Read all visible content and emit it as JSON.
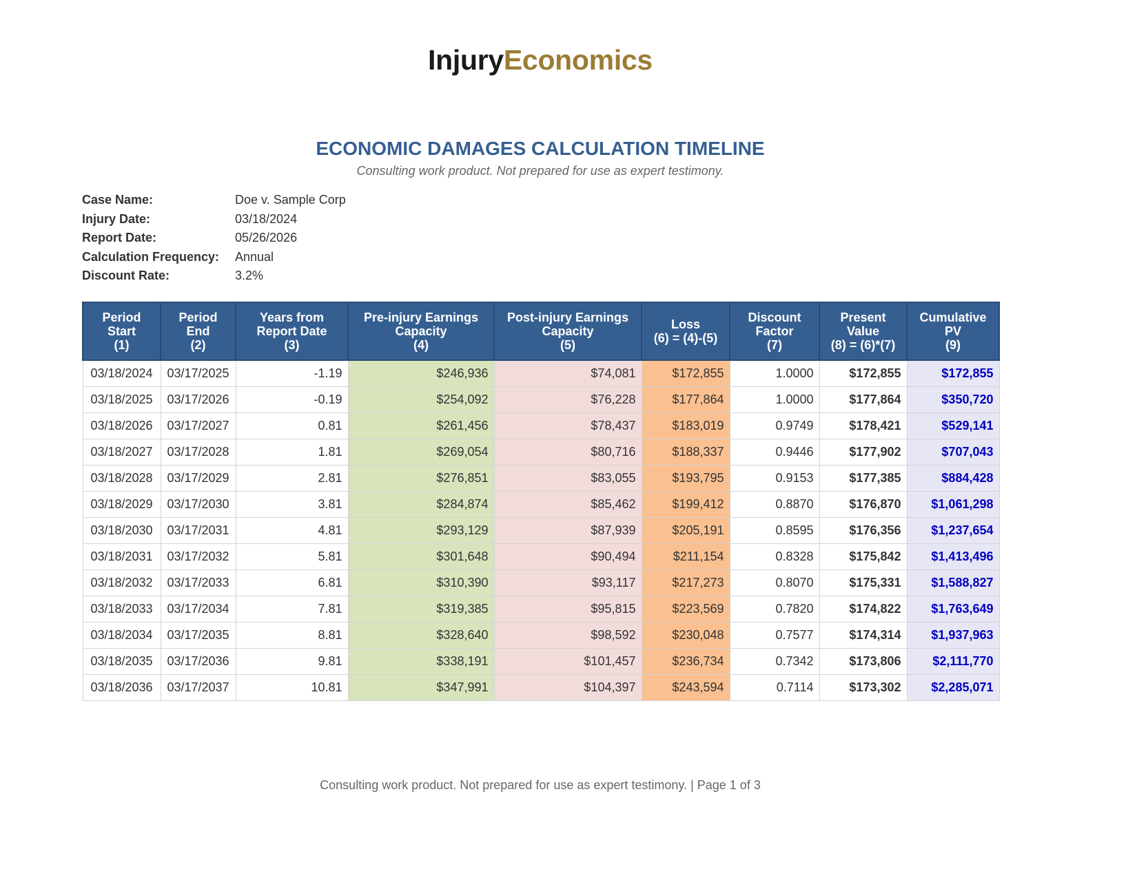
{
  "logo": {
    "part1": "Injury",
    "part2": "Economics"
  },
  "title": "ECONOMIC DAMAGES CALCULATION TIMELINE",
  "subtitle": "Consulting work product. Not prepared for use as expert testimony.",
  "case_info": [
    {
      "label": "Case Name:",
      "value": "Doe v. Sample Corp"
    },
    {
      "label": "Injury Date:",
      "value": "03/18/2024"
    },
    {
      "label": "Report Date:",
      "value": "05/26/2026"
    },
    {
      "label": "Calculation Frequency:",
      "value": "Annual"
    },
    {
      "label": "Discount Rate:",
      "value": "3.2%"
    }
  ],
  "table": {
    "headers": [
      [
        "Period",
        "Start",
        "(1)"
      ],
      [
        "Period",
        "End",
        "(2)"
      ],
      [
        "Years from",
        "Report Date",
        "(3)"
      ],
      [
        "Pre-injury Earnings",
        "Capacity",
        "(4)"
      ],
      [
        "Post-injury Earnings",
        "Capacity",
        "(5)"
      ],
      [
        "Loss",
        "(6) = (4)-(5)"
      ],
      [
        "Discount",
        "Factor",
        "(7)"
      ],
      [
        "Present",
        "Value",
        "(8) = (6)*(7)"
      ],
      [
        "Cumulative",
        "PV",
        "(9)"
      ]
    ],
    "rows": [
      [
        "03/18/2024",
        "03/17/2025",
        "-1.19",
        "$246,936",
        "$74,081",
        "$172,855",
        "1.0000",
        "$172,855",
        "$172,855"
      ],
      [
        "03/18/2025",
        "03/17/2026",
        "-0.19",
        "$254,092",
        "$76,228",
        "$177,864",
        "1.0000",
        "$177,864",
        "$350,720"
      ],
      [
        "03/18/2026",
        "03/17/2027",
        "0.81",
        "$261,456",
        "$78,437",
        "$183,019",
        "0.9749",
        "$178,421",
        "$529,141"
      ],
      [
        "03/18/2027",
        "03/17/2028",
        "1.81",
        "$269,054",
        "$80,716",
        "$188,337",
        "0.9446",
        "$177,902",
        "$707,043"
      ],
      [
        "03/18/2028",
        "03/17/2029",
        "2.81",
        "$276,851",
        "$83,055",
        "$193,795",
        "0.9153",
        "$177,385",
        "$884,428"
      ],
      [
        "03/18/2029",
        "03/17/2030",
        "3.81",
        "$284,874",
        "$85,462",
        "$199,412",
        "0.8870",
        "$176,870",
        "$1,061,298"
      ],
      [
        "03/18/2030",
        "03/17/2031",
        "4.81",
        "$293,129",
        "$87,939",
        "$205,191",
        "0.8595",
        "$176,356",
        "$1,237,654"
      ],
      [
        "03/18/2031",
        "03/17/2032",
        "5.81",
        "$301,648",
        "$90,494",
        "$211,154",
        "0.8328",
        "$175,842",
        "$1,413,496"
      ],
      [
        "03/18/2032",
        "03/17/2033",
        "6.81",
        "$310,390",
        "$93,117",
        "$217,273",
        "0.8070",
        "$175,331",
        "$1,588,827"
      ],
      [
        "03/18/2033",
        "03/17/2034",
        "7.81",
        "$319,385",
        "$95,815",
        "$223,569",
        "0.7820",
        "$174,822",
        "$1,763,649"
      ],
      [
        "03/18/2034",
        "03/17/2035",
        "8.81",
        "$328,640",
        "$98,592",
        "$230,048",
        "0.7577",
        "$174,314",
        "$1,937,963"
      ],
      [
        "03/18/2035",
        "03/17/2036",
        "9.81",
        "$338,191",
        "$101,457",
        "$236,734",
        "0.7342",
        "$173,806",
        "$2,111,770"
      ],
      [
        "03/18/2036",
        "03/17/2037",
        "10.81",
        "$347,991",
        "$104,397",
        "$243,594",
        "0.7114",
        "$173,302",
        "$2,285,071"
      ]
    ]
  },
  "footer": "Consulting work product. Not prepared for use as expert testimony. | Page 1 of 3",
  "colors": {
    "title": "#365f91",
    "header_bg": "#365f91",
    "logo_accent": "#9c7c35",
    "pre_injury_bg": "#d8e4bc",
    "post_injury_bg": "#f2dcdb",
    "loss_bg": "#fac090",
    "cumulative_bg": "#e6e6f5",
    "cumulative_text": "#0000c0"
  }
}
